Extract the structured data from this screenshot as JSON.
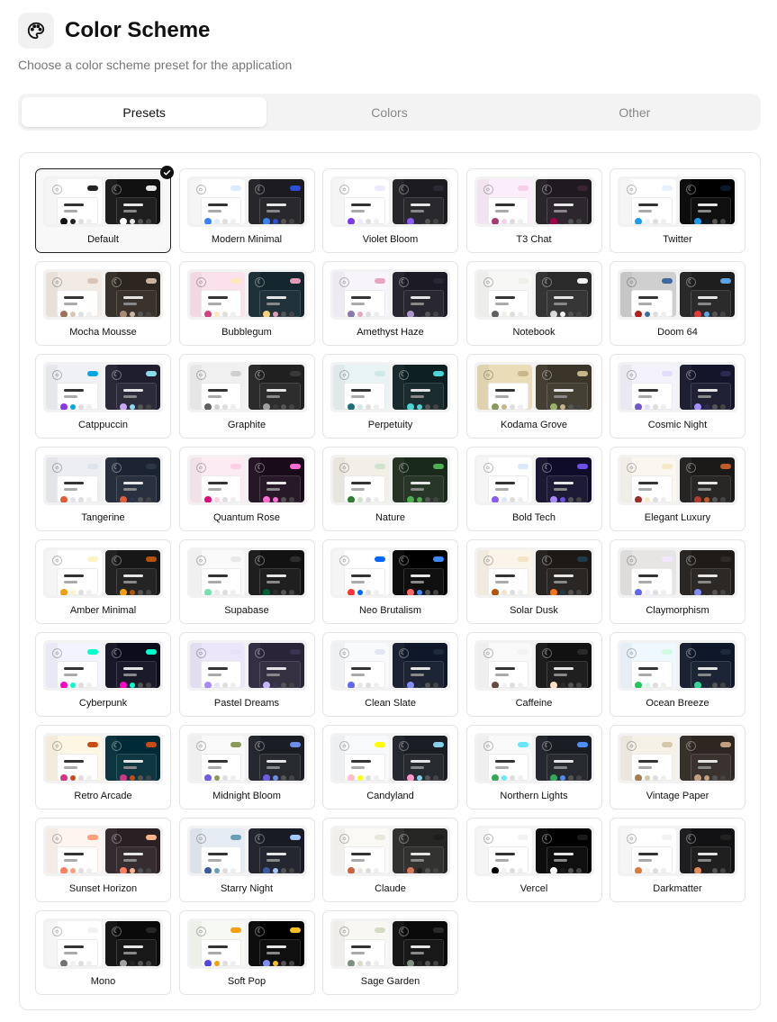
{
  "header": {
    "icon": "palette-icon",
    "title": "Color Scheme",
    "subtitle": "Choose a color scheme preset for the application"
  },
  "tabs": [
    {
      "label": "Presets",
      "active": true
    },
    {
      "label": "Colors",
      "active": false
    },
    {
      "label": "Other",
      "active": false
    }
  ],
  "selected_preset": "Default",
  "presets": [
    {
      "name": "Default",
      "light": {
        "bg": "#ffffff",
        "primary": "#222222",
        "accent": "#111111"
      },
      "dark": {
        "bg": "#111111",
        "primary": "#e6e6e6",
        "accent": "#ffffff"
      }
    },
    {
      "name": "Modern Minimal",
      "light": {
        "bg": "#ffffff",
        "primary": "#dbeafe",
        "accent": "#3b82f6"
      },
      "dark": {
        "bg": "#1c1c20",
        "primary": "#2d4ed8",
        "accent": "#3b82f6"
      }
    },
    {
      "name": "Violet Bloom",
      "light": {
        "bg": "#ffffff",
        "primary": "#ede9fe",
        "accent": "#7c3aed"
      },
      "dark": {
        "bg": "#1c1c20",
        "primary": "#2a2a35",
        "accent": "#8b5cf6"
      }
    },
    {
      "name": "T3 Chat",
      "light": {
        "bg": "#fbeefa",
        "primary": "#f6cfe8",
        "accent": "#a23b72"
      },
      "dark": {
        "bg": "#1e1a20",
        "primary": "#3a2433",
        "accent": "#a3004c"
      }
    },
    {
      "name": "Twitter",
      "light": {
        "bg": "#ffffff",
        "primary": "#e8f1fb",
        "accent": "#1d9bf0"
      },
      "dark": {
        "bg": "#000000",
        "primary": "#0b1a2a",
        "accent": "#1d9bf0"
      }
    },
    {
      "name": "Mocha Mousse",
      "light": {
        "bg": "#f1ebe3",
        "primary": "#d7c6b5",
        "accent": "#9d7158"
      },
      "dark": {
        "bg": "#2d2620",
        "primary": "#c9b49f",
        "accent": "#a88b72"
      }
    },
    {
      "name": "Bubblegum",
      "light": {
        "bg": "#fbe1ec",
        "primary": "#fde7ba",
        "accent": "#d2457a"
      },
      "dark": {
        "bg": "#13262e",
        "primary": "#e49ab5",
        "accent": "#f4d27c"
      }
    },
    {
      "name": "Amethyst Haze",
      "light": {
        "bg": "#f7f5fb",
        "primary": "#e9a5c1",
        "accent": "#8a79ab"
      },
      "dark": {
        "bg": "#1c1a24",
        "primary": "#2a2735",
        "accent": "#a995c9"
      }
    },
    {
      "name": "Notebook",
      "light": {
        "bg": "#f7f7f5",
        "primary": "#f0efe9",
        "accent": "#606060"
      },
      "dark": {
        "bg": "#2a2a2a",
        "primary": "#f2f2f2",
        "accent": "#d9d9d9"
      }
    },
    {
      "name": "Doom 64",
      "light": {
        "bg": "#cfcfcf",
        "primary": "#3b6b9e",
        "accent": "#b71c1c"
      },
      "dark": {
        "bg": "#1e1e1e",
        "primary": "#5ba4e5",
        "accent": "#e53935"
      }
    },
    {
      "name": "Catppuccin",
      "light": {
        "bg": "#eff1f5",
        "primary": "#04a5e5",
        "accent": "#8839ef"
      },
      "dark": {
        "bg": "#1e1e2e",
        "primary": "#89dceb",
        "accent": "#cba6f7"
      }
    },
    {
      "name": "Graphite",
      "light": {
        "bg": "#f0f0f0",
        "primary": "#d0d0d0",
        "accent": "#606060"
      },
      "dark": {
        "bg": "#202020",
        "primary": "#3a3a3a",
        "accent": "#a0a0a0"
      }
    },
    {
      "name": "Perpetuity",
      "light": {
        "bg": "#e8f4f4",
        "primary": "#cfe8e8",
        "accent": "#1f6f78"
      },
      "dark": {
        "bg": "#0d1f21",
        "primary": "#4ad6d6",
        "accent": "#4ad6d6"
      }
    },
    {
      "name": "Kodama Grove",
      "light": {
        "bg": "#e9dcb7",
        "primary": "#c9b68a",
        "accent": "#8a9a5b"
      },
      "dark": {
        "bg": "#3a3528",
        "primary": "#c4b58a",
        "accent": "#9bb068"
      }
    },
    {
      "name": "Cosmic Night",
      "light": {
        "bg": "#f4f3fb",
        "primary": "#e0defa",
        "accent": "#6e56cf"
      },
      "dark": {
        "bg": "#14142a",
        "primary": "#2b2b52",
        "accent": "#a48fff"
      }
    },
    {
      "name": "Tangerine",
      "light": {
        "bg": "#eceef2",
        "primary": "#dfe3ea",
        "accent": "#e05d38"
      },
      "dark": {
        "bg": "#1c2433",
        "primary": "#2b3647",
        "accent": "#e05d38"
      }
    },
    {
      "name": "Quantum Rose",
      "light": {
        "bg": "#fdebf4",
        "primary": "#fbcfe4",
        "accent": "#e6067a"
      },
      "dark": {
        "bg": "#1a0b1a",
        "primary": "#ff6bd1",
        "accent": "#ff6bd1"
      }
    },
    {
      "name": "Nature",
      "light": {
        "bg": "#f2efe6",
        "primary": "#cfe3cc",
        "accent": "#2e7d32"
      },
      "dark": {
        "bg": "#1a2a1a",
        "primary": "#4caf50",
        "accent": "#4caf50"
      }
    },
    {
      "name": "Bold Tech",
      "light": {
        "bg": "#ffffff",
        "primary": "#dbe8fb",
        "accent": "#8b5cf6"
      },
      "dark": {
        "bg": "#0f0c29",
        "primary": "#6d4ee8",
        "accent": "#a78bfa"
      }
    },
    {
      "name": "Elegant Luxury",
      "light": {
        "bg": "#faf7f0",
        "primary": "#f5e9c6",
        "accent": "#9b2c2c"
      },
      "dark": {
        "bg": "#1c1a18",
        "primary": "#c05a2a",
        "accent": "#b03b2e"
      }
    },
    {
      "name": "Amber Minimal",
      "light": {
        "bg": "#ffffff",
        "primary": "#fef3c7",
        "accent": "#f59e0b"
      },
      "dark": {
        "bg": "#171717",
        "primary": "#b45309",
        "accent": "#f59e0b"
      }
    },
    {
      "name": "Supabase",
      "light": {
        "bg": "#fafafa",
        "primary": "#e8e8e8",
        "accent": "#72e3ad"
      },
      "dark": {
        "bg": "#121212",
        "primary": "#2e2e2e",
        "accent": "#006239"
      }
    },
    {
      "name": "Neo Brutalism",
      "light": {
        "bg": "#ffffff",
        "primary": "#0066ff",
        "accent": "#ff3333"
      },
      "dark": {
        "bg": "#000000",
        "primary": "#3a8bff",
        "accent": "#ff6666"
      }
    },
    {
      "name": "Solar Dusk",
      "light": {
        "bg": "#faf4e9",
        "primary": "#f4e3c4",
        "accent": "#b45309"
      },
      "dark": {
        "bg": "#1c1917",
        "primary": "#1f3a4a",
        "accent": "#f97316"
      }
    },
    {
      "name": "Claymorphism",
      "light": {
        "bg": "#e7e5e4",
        "primary": "#f3e8ff",
        "accent": "#6366f1"
      },
      "dark": {
        "bg": "#1e1b18",
        "primary": "#2d2a27",
        "accent": "#818cf8"
      }
    },
    {
      "name": "Cyberpunk",
      "light": {
        "bg": "#f3f2ff",
        "primary": "#00ffcc",
        "accent": "#ff00c8"
      },
      "dark": {
        "bg": "#0c0c1d",
        "primary": "#00ffcc",
        "accent": "#ff00c8"
      }
    },
    {
      "name": "Pastel Dreams",
      "light": {
        "bg": "#ece6fb",
        "primary": "#e8e1fa",
        "accent": "#a78bfa"
      },
      "dark": {
        "bg": "#2a2438",
        "primary": "#3b3350",
        "accent": "#c4b5fd"
      }
    },
    {
      "name": "Clean Slate",
      "light": {
        "bg": "#f8fafc",
        "primary": "#e2e8f0",
        "accent": "#6366f1"
      },
      "dark": {
        "bg": "#0f172a",
        "primary": "#1e293b",
        "accent": "#818cf8"
      }
    },
    {
      "name": "Caffeine",
      "light": {
        "bg": "#f9f9f9",
        "primary": "#f2f2f2",
        "accent": "#644a40"
      },
      "dark": {
        "bg": "#111111",
        "primary": "#2a2a2a",
        "accent": "#ffe0c2"
      }
    },
    {
      "name": "Ocean Breeze",
      "light": {
        "bg": "#f0f8ff",
        "primary": "#d1fae5",
        "accent": "#22c55e"
      },
      "dark": {
        "bg": "#0f172a",
        "primary": "#1e293b",
        "accent": "#34d399"
      }
    },
    {
      "name": "Retro Arcade",
      "light": {
        "bg": "#fdf6e3",
        "primary": "#cb4b16",
        "accent": "#d33682"
      },
      "dark": {
        "bg": "#002b36",
        "primary": "#cb4b16",
        "accent": "#d33682"
      }
    },
    {
      "name": "Midnight Bloom",
      "light": {
        "bg": "#f9f9f9",
        "primary": "#8a9a5b",
        "accent": "#6c5ce7"
      },
      "dark": {
        "bg": "#1a1d23",
        "primary": "#6c8ee7",
        "accent": "#6c5ce7"
      }
    },
    {
      "name": "Candyland",
      "light": {
        "bg": "#f7f9fa",
        "primary": "#ffff00",
        "accent": "#ffc0cb"
      },
      "dark": {
        "bg": "#1a1d23",
        "primary": "#87ceeb",
        "accent": "#ff99cc"
      }
    },
    {
      "name": "Northern Lights",
      "light": {
        "bg": "#f9f9fa",
        "primary": "#67e8f9",
        "accent": "#34a85a"
      },
      "dark": {
        "bg": "#1a1d23",
        "primary": "#4f8ef7",
        "accent": "#34a85a"
      }
    },
    {
      "name": "Vintage Paper",
      "light": {
        "bg": "#f5f1e6",
        "primary": "#d4c8aa",
        "accent": "#a67c52"
      },
      "dark": {
        "bg": "#2d2621",
        "primary": "#c0a080",
        "accent": "#c0a080"
      }
    },
    {
      "name": "Sunset Horizon",
      "light": {
        "bg": "#fff5f0",
        "primary": "#ffa07a",
        "accent": "#ff7e5f"
      },
      "dark": {
        "bg": "#2a2024",
        "primary": "#ffb38a",
        "accent": "#ff7e5f"
      }
    },
    {
      "name": "Starry Night",
      "light": {
        "bg": "#e6ecf4",
        "primary": "#6a9fb5",
        "accent": "#3a5ba0"
      },
      "dark": {
        "bg": "#181a24",
        "primary": "#a4c8ff",
        "accent": "#3a5ba0"
      }
    },
    {
      "name": "Claude",
      "light": {
        "bg": "#faf9f5",
        "primary": "#e9e6dc",
        "accent": "#c96442"
      },
      "dark": {
        "bg": "#262624",
        "primary": "#1f1e1d",
        "accent": "#d97757"
      }
    },
    {
      "name": "Vercel",
      "light": {
        "bg": "#ffffff",
        "primary": "#f2f2f2",
        "accent": "#000000"
      },
      "dark": {
        "bg": "#000000",
        "primary": "#1a1a1a",
        "accent": "#ffffff"
      }
    },
    {
      "name": "Darkmatter",
      "light": {
        "bg": "#ffffff",
        "primary": "#f2f2f2",
        "accent": "#d87943"
      },
      "dark": {
        "bg": "#121113",
        "primary": "#222222",
        "accent": "#e78a53"
      }
    },
    {
      "name": "Mono",
      "light": {
        "bg": "#ffffff",
        "primary": "#f2f2f2",
        "accent": "#737373"
      },
      "dark": {
        "bg": "#0a0a0a",
        "primary": "#262626",
        "accent": "#a3a3a3"
      }
    },
    {
      "name": "Soft Pop",
      "light": {
        "bg": "#f7f9f3",
        "primary": "#f59e0b",
        "accent": "#4f46e5"
      },
      "dark": {
        "bg": "#000000",
        "primary": "#fbbf24",
        "accent": "#818cf8"
      }
    },
    {
      "name": "Sage Garden",
      "light": {
        "bg": "#f8f7f4",
        "primary": "#d6dbc8",
        "accent": "#7c9082"
      },
      "dark": {
        "bg": "#0a0a0a",
        "primary": "#2a2a2a",
        "accent": "#7c9082"
      }
    }
  ]
}
